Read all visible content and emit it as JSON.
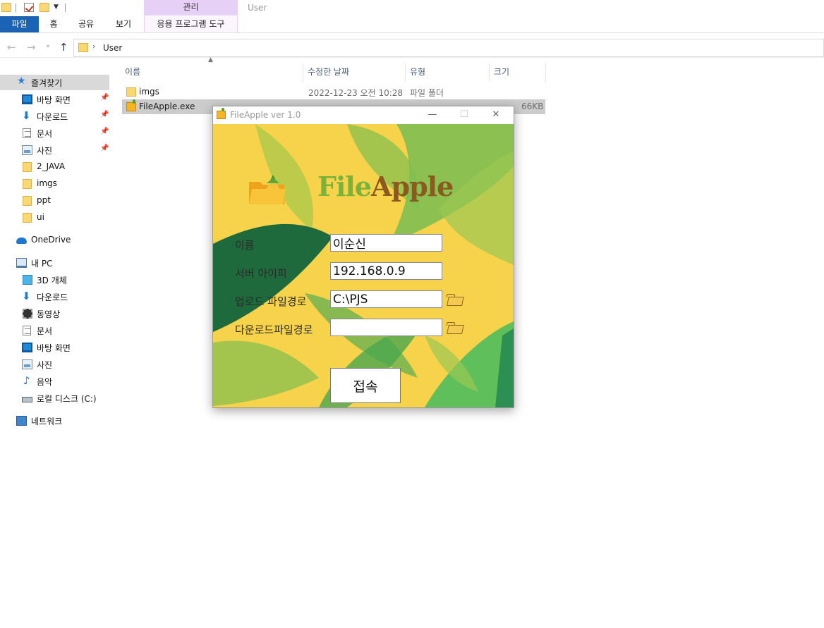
{
  "explorer": {
    "window_title": "User",
    "context_tab_header": "관리",
    "ribbon_tabs": [
      "파일",
      "홈",
      "공유",
      "보기",
      "응용 프로그램 도구"
    ],
    "address_path": "User",
    "nav": {
      "favorites": "즐겨찾기",
      "quick_access": [
        {
          "label": "바탕 화면",
          "icon": "desktop-icon"
        },
        {
          "label": "다운로드",
          "icon": "download-icon"
        },
        {
          "label": "문서",
          "icon": "documents-icon"
        },
        {
          "label": "사진",
          "icon": "pictures-icon"
        },
        {
          "label": "2_JAVA",
          "icon": "folder-icon"
        },
        {
          "label": "imgs",
          "icon": "folder-icon"
        },
        {
          "label": "ppt",
          "icon": "folder-icon"
        },
        {
          "label": "ui",
          "icon": "folder-icon"
        }
      ],
      "onedrive": "OneDrive",
      "this_pc": "내 PC",
      "pc_items": [
        {
          "label": "3D 개체",
          "icon": "3d-objects-icon"
        },
        {
          "label": "다운로드",
          "icon": "download-icon"
        },
        {
          "label": "동영상",
          "icon": "videos-icon"
        },
        {
          "label": "문서",
          "icon": "documents-icon"
        },
        {
          "label": "바탕 화면",
          "icon": "desktop-icon"
        },
        {
          "label": "사진",
          "icon": "pictures-icon"
        },
        {
          "label": "음악",
          "icon": "music-icon"
        },
        {
          "label": "로컬 디스크 (C:)",
          "icon": "local-disk-icon"
        }
      ],
      "network": "네트워크"
    },
    "columns": [
      "이름",
      "수정한 날짜",
      "유형",
      "크기"
    ],
    "files": [
      {
        "name": "imgs",
        "modified": "2022-12-23 오전 10:28",
        "type": "파일 폴더",
        "size": ""
      },
      {
        "name": "FileApple.exe",
        "modified": "",
        "type": "",
        "size": "66KB"
      }
    ]
  },
  "app": {
    "window_title": "FileApple ver 1.0",
    "logo_file": "File",
    "logo_apple": "Apple",
    "fields": {
      "name_label": "이름",
      "name_value": "이순신",
      "ip_label": "서버 아이피",
      "ip_value": "192.168.0.9",
      "upload_label": "업로드 파일경로",
      "upload_value": "C:\\PJS",
      "download_label": "다운로드파일경로",
      "download_value": ""
    },
    "connect_label": "접속"
  },
  "colors": {
    "accent": "#1a63b5",
    "context_tab": "#e6d0f5",
    "app_background": "#f7d34c",
    "logo_file": "#7bb33a",
    "logo_apple": "#8b5a1e"
  }
}
